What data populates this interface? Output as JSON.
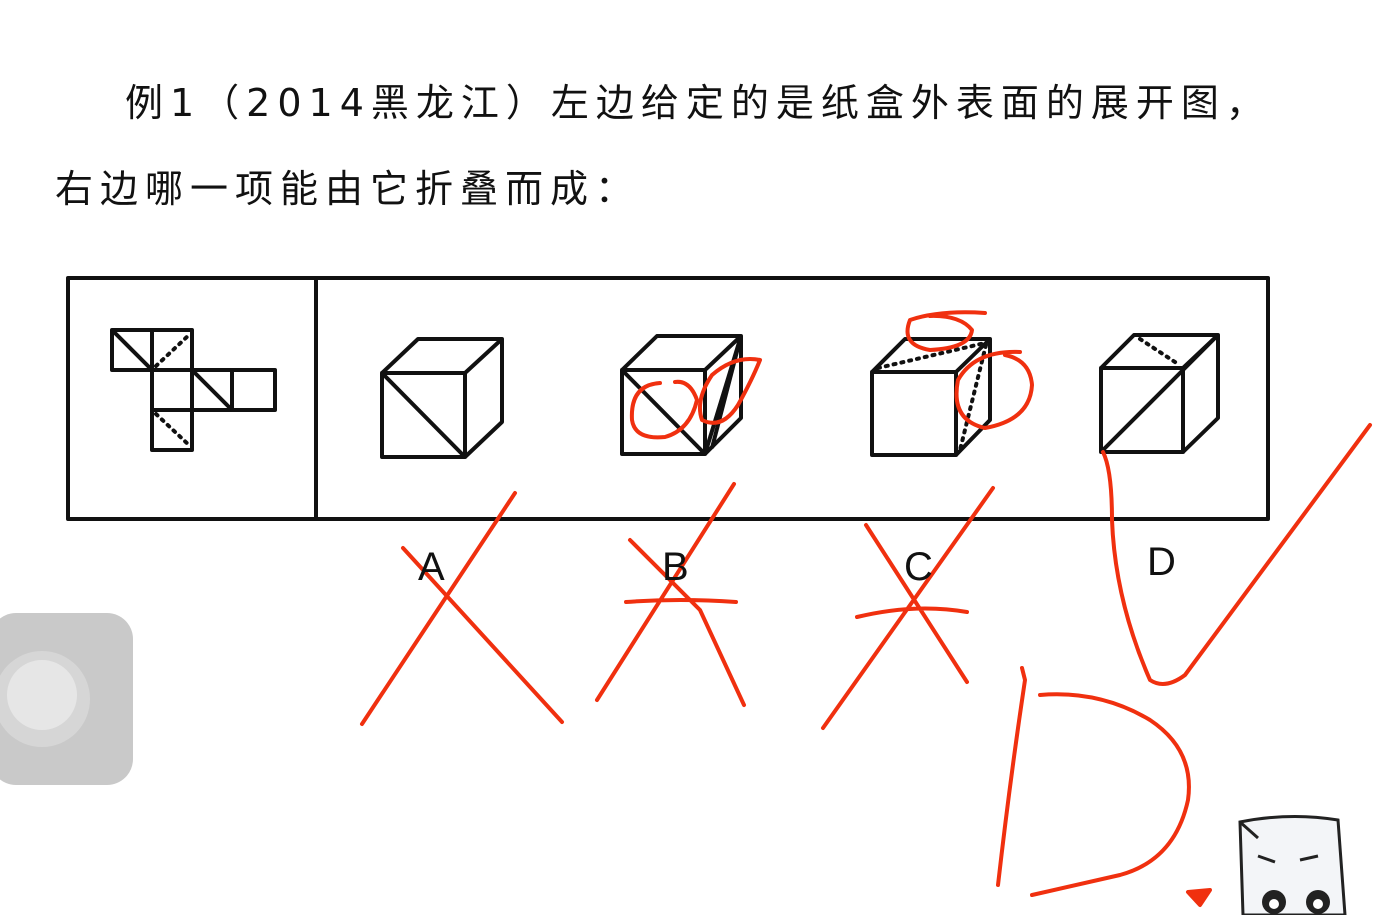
{
  "question": {
    "line1": "例1（2014黑龙江）左边给定的是纸盒外表面的展开图，",
    "line2": "右边哪一项能由它折叠而成："
  },
  "options": [
    "A",
    "B",
    "C",
    "D"
  ],
  "colors": {
    "annotation": "#f0300f",
    "ink": "#111111"
  },
  "icons": [
    "floating-assistive-button",
    "mascot-icon"
  ]
}
